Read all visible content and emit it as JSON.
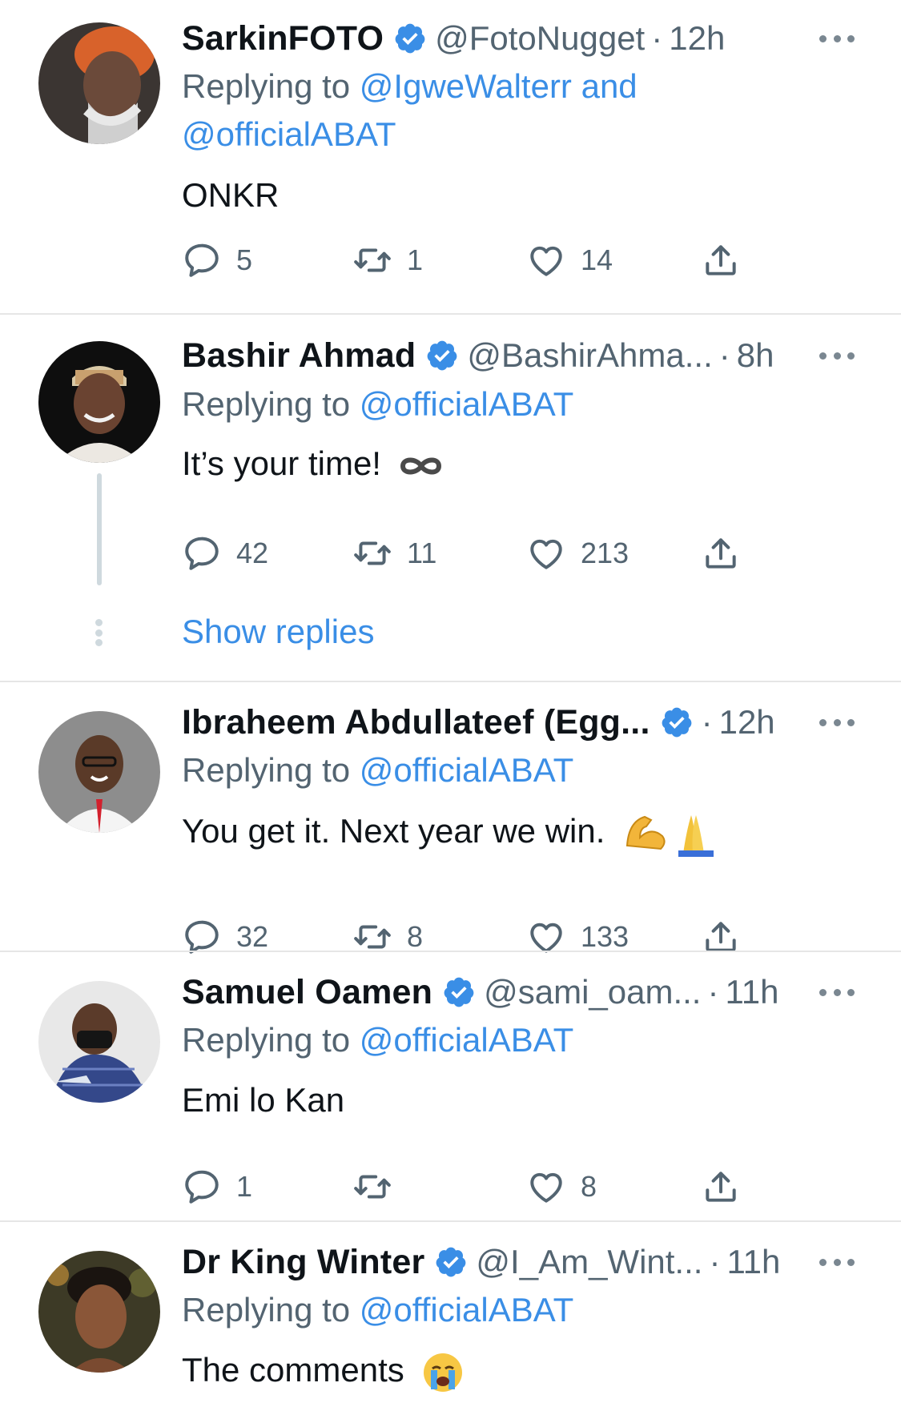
{
  "colors": {
    "accent": "#3a8ee6",
    "secondary_text": "#536471",
    "divider": "#e6e6e6",
    "thread": "#cfd9de"
  },
  "tweets": [
    {
      "name": "SarkinFOTO",
      "handle": "@FotoNugget",
      "dot": "·",
      "time": "12h",
      "replying_prefix": "Replying to ",
      "replying_to": "@IgweWalterr and @officialABAT",
      "text": "ONKR",
      "replies": "5",
      "retweets": "1",
      "likes": "14"
    },
    {
      "name": "Bashir Ahmad",
      "handle": "@BashirAhma...",
      "dot": "·",
      "time": "8h",
      "replying_prefix": "Replying to ",
      "replying_to": "@officialABAT",
      "text": "It’s your time!",
      "emoji": "infinity-icon",
      "replies": "42",
      "retweets": "11",
      "likes": "213",
      "show_replies": "Show replies"
    },
    {
      "name": "Ibraheem Abdullateef (Egg...",
      "handle": "",
      "dot": "·",
      "time": "12h",
      "replying_prefix": "Replying to ",
      "replying_to": "@officialABAT",
      "text": "You get it. Next year we win.",
      "emoji": "flexed-biceps-and-folded-hands-emoji",
      "replies": "32",
      "retweets": "8",
      "likes": "133"
    },
    {
      "name": "Samuel Oamen",
      "handle": "@sami_oam...",
      "dot": "·",
      "time": "11h",
      "replying_prefix": "Replying to ",
      "replying_to": "@officialABAT",
      "text": "Emi lo Kan",
      "replies": "1",
      "retweets": "",
      "likes": "8"
    },
    {
      "name": "Dr King Winter",
      "handle": "@I_Am_Wint...",
      "dot": "·",
      "time": "11h",
      "replying_prefix": "Replying to ",
      "replying_to": "@officialABAT",
      "text": "The comments",
      "emoji": "loudly-crying-face-emoji"
    }
  ]
}
